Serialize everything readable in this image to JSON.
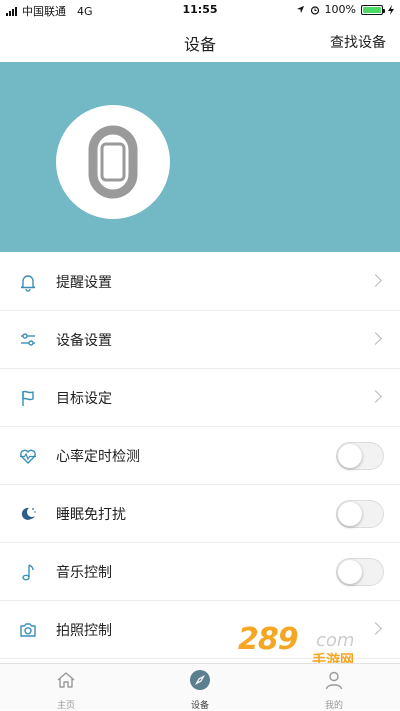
{
  "status_bar": {
    "carrier": "中国联通",
    "network": "4G",
    "time": "11:55",
    "battery": "100%",
    "battery_level": 1.0
  },
  "nav": {
    "title": "设备",
    "action": "查找设备"
  },
  "banner": {
    "bg_color": "#72b8c5",
    "device_icon": "band-icon"
  },
  "menu": {
    "items": [
      {
        "label": "提醒设置",
        "icon": "bell-icon",
        "control": "chevron"
      },
      {
        "label": "设备设置",
        "icon": "sliders-icon",
        "control": "chevron"
      },
      {
        "label": "目标设定",
        "icon": "flag-icon",
        "control": "chevron"
      },
      {
        "label": "心率定时检测",
        "icon": "heart-rate-icon",
        "control": "toggle",
        "on": false
      },
      {
        "label": "睡眠免打扰",
        "icon": "moon-icon",
        "control": "toggle",
        "on": false
      },
      {
        "label": "音乐控制",
        "icon": "music-note-icon",
        "control": "toggle",
        "on": false
      },
      {
        "label": "拍照控制",
        "icon": "camera-icon",
        "control": "chevron"
      }
    ]
  },
  "tabbar": {
    "tabs": [
      {
        "label": "主页",
        "icon": "home-icon",
        "active": false
      },
      {
        "label": "设备",
        "icon": "compass-icon",
        "active": true
      },
      {
        "label": "我的",
        "icon": "person-icon",
        "active": false
      }
    ]
  },
  "watermark": {
    "number": "289",
    "domain": "com",
    "text": "手游网"
  },
  "colors": {
    "accent": "#72b8c5",
    "icon": "#3a8fb7",
    "active_tab": "#5c7f8f"
  }
}
